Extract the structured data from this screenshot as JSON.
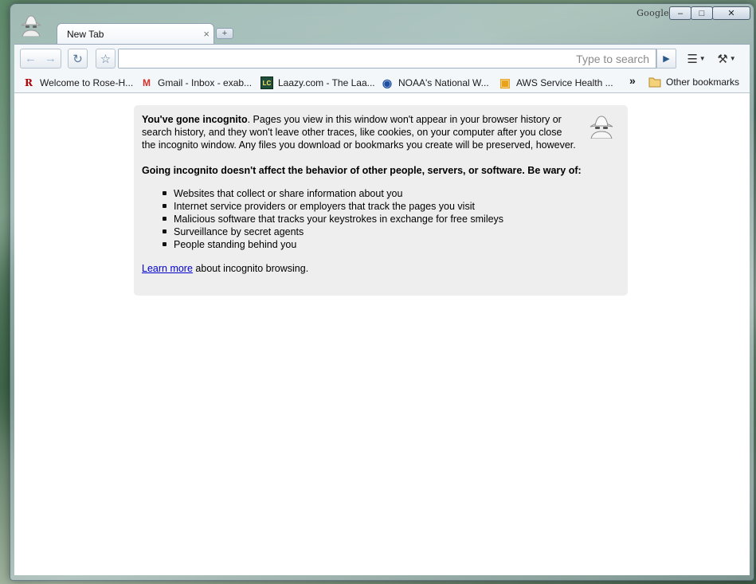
{
  "window": {
    "brand": "Google",
    "minimize": "–",
    "maximize": "□",
    "close": "✕"
  },
  "tab": {
    "title": "New Tab",
    "close": "×",
    "new_tab": "+"
  },
  "toolbar": {
    "back_icon": "←",
    "forward_icon": "→",
    "reload_icon": "↻",
    "star_icon": "☆",
    "omnibox_placeholder": "Type to search",
    "go_icon": "▶",
    "page_icon": "☰",
    "wrench_icon": "⚒"
  },
  "bookmarks": {
    "items": [
      {
        "label": "Welcome to Rose-H...",
        "icon": "R"
      },
      {
        "label": "Gmail - Inbox - exab...",
        "icon": "M"
      },
      {
        "label": "Laazy.com - The Laa...",
        "icon": "LC"
      },
      {
        "label": "NOAA's National W...",
        "icon": "◉"
      },
      {
        "label": "AWS Service Health ...",
        "icon": "▣"
      }
    ],
    "overflow": "»",
    "other": "Other bookmarks"
  },
  "incognito": {
    "intro_bold": "You've gone incognito",
    "intro_rest": ". Pages you view in this window won't appear in your browser history or search history, and they won't leave other traces, like cookies, on your computer after you close the incognito window. Any files you download or bookmarks you create will be preserved, however.",
    "heading": "Going incognito doesn't affect the behavior of other people, servers, or software. Be wary of:",
    "warnings": [
      "Websites that collect or share information about you",
      "Internet service providers or employers that track the pages you visit",
      "Malicious software that tracks your keystrokes in exchange for free smileys",
      "Surveillance by secret agents",
      "People standing behind you"
    ],
    "learn_link": "Learn more",
    "learn_rest": " about incognito browsing."
  }
}
